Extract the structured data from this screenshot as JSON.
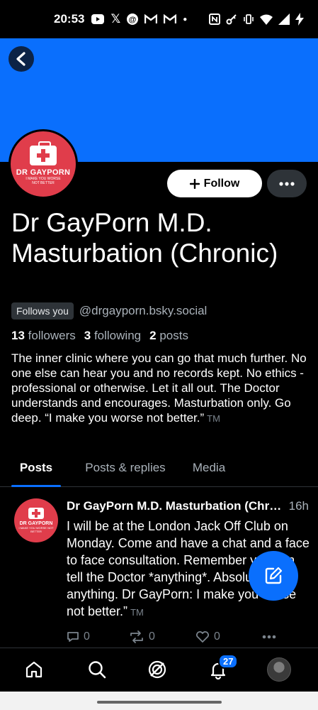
{
  "status_bar": {
    "time": "20:53",
    "left_icons": [
      "youtube-icon",
      "x-icon",
      "threads-icon",
      "gmail-icon",
      "gmail-icon",
      "dot-icon"
    ],
    "right_icons": [
      "nfc-icon",
      "key-icon",
      "vibrate-icon",
      "wifi-icon",
      "signal-icon",
      "charging-icon"
    ]
  },
  "colors": {
    "banner": "#0a6ffd",
    "accent": "#0a6ffd",
    "avatar_bg": "#e03d4b"
  },
  "profile": {
    "avatar_name": "DR GAYPORN",
    "avatar_tagline": "I MAKE YOU WORSE NOT BETTER",
    "follow_label": "Follow",
    "display_name": "Dr GayPorn M.D. Masturbation (Chronic)",
    "follows_you": "Follows you",
    "handle": "@drgayporn.bsky.social",
    "followers_count": "13",
    "followers_label": "followers",
    "following_count": "3",
    "following_label": "following",
    "posts_count": "2",
    "posts_label": "posts",
    "bio": "The inner clinic where you can go that much further. No one else can hear you and no records kept. No ethics - professional or otherwise. Let it all out. The Doctor understands and encourages. Masturbation only. Go deep. “I make you worse not better.”",
    "bio_tm": "TM"
  },
  "tabs": [
    {
      "label": "Posts",
      "active": true
    },
    {
      "label": "Posts & replies",
      "active": false
    },
    {
      "label": "Media",
      "active": false
    }
  ],
  "post": {
    "author": "Dr GayPorn M.D. Masturbation (Chronic)",
    "time": "16h",
    "body": "I will be at the London Jack Off Club on Monday. Come and have a chat and a face to face consultation. Remember you can tell the Doctor *anything*. Absolutely anything. Dr GayPorn: I make you worse not better.”",
    "body_tm": "TM",
    "replies": "0",
    "reposts": "0",
    "likes": "0"
  },
  "bottom_nav": {
    "notification_count": "27"
  }
}
